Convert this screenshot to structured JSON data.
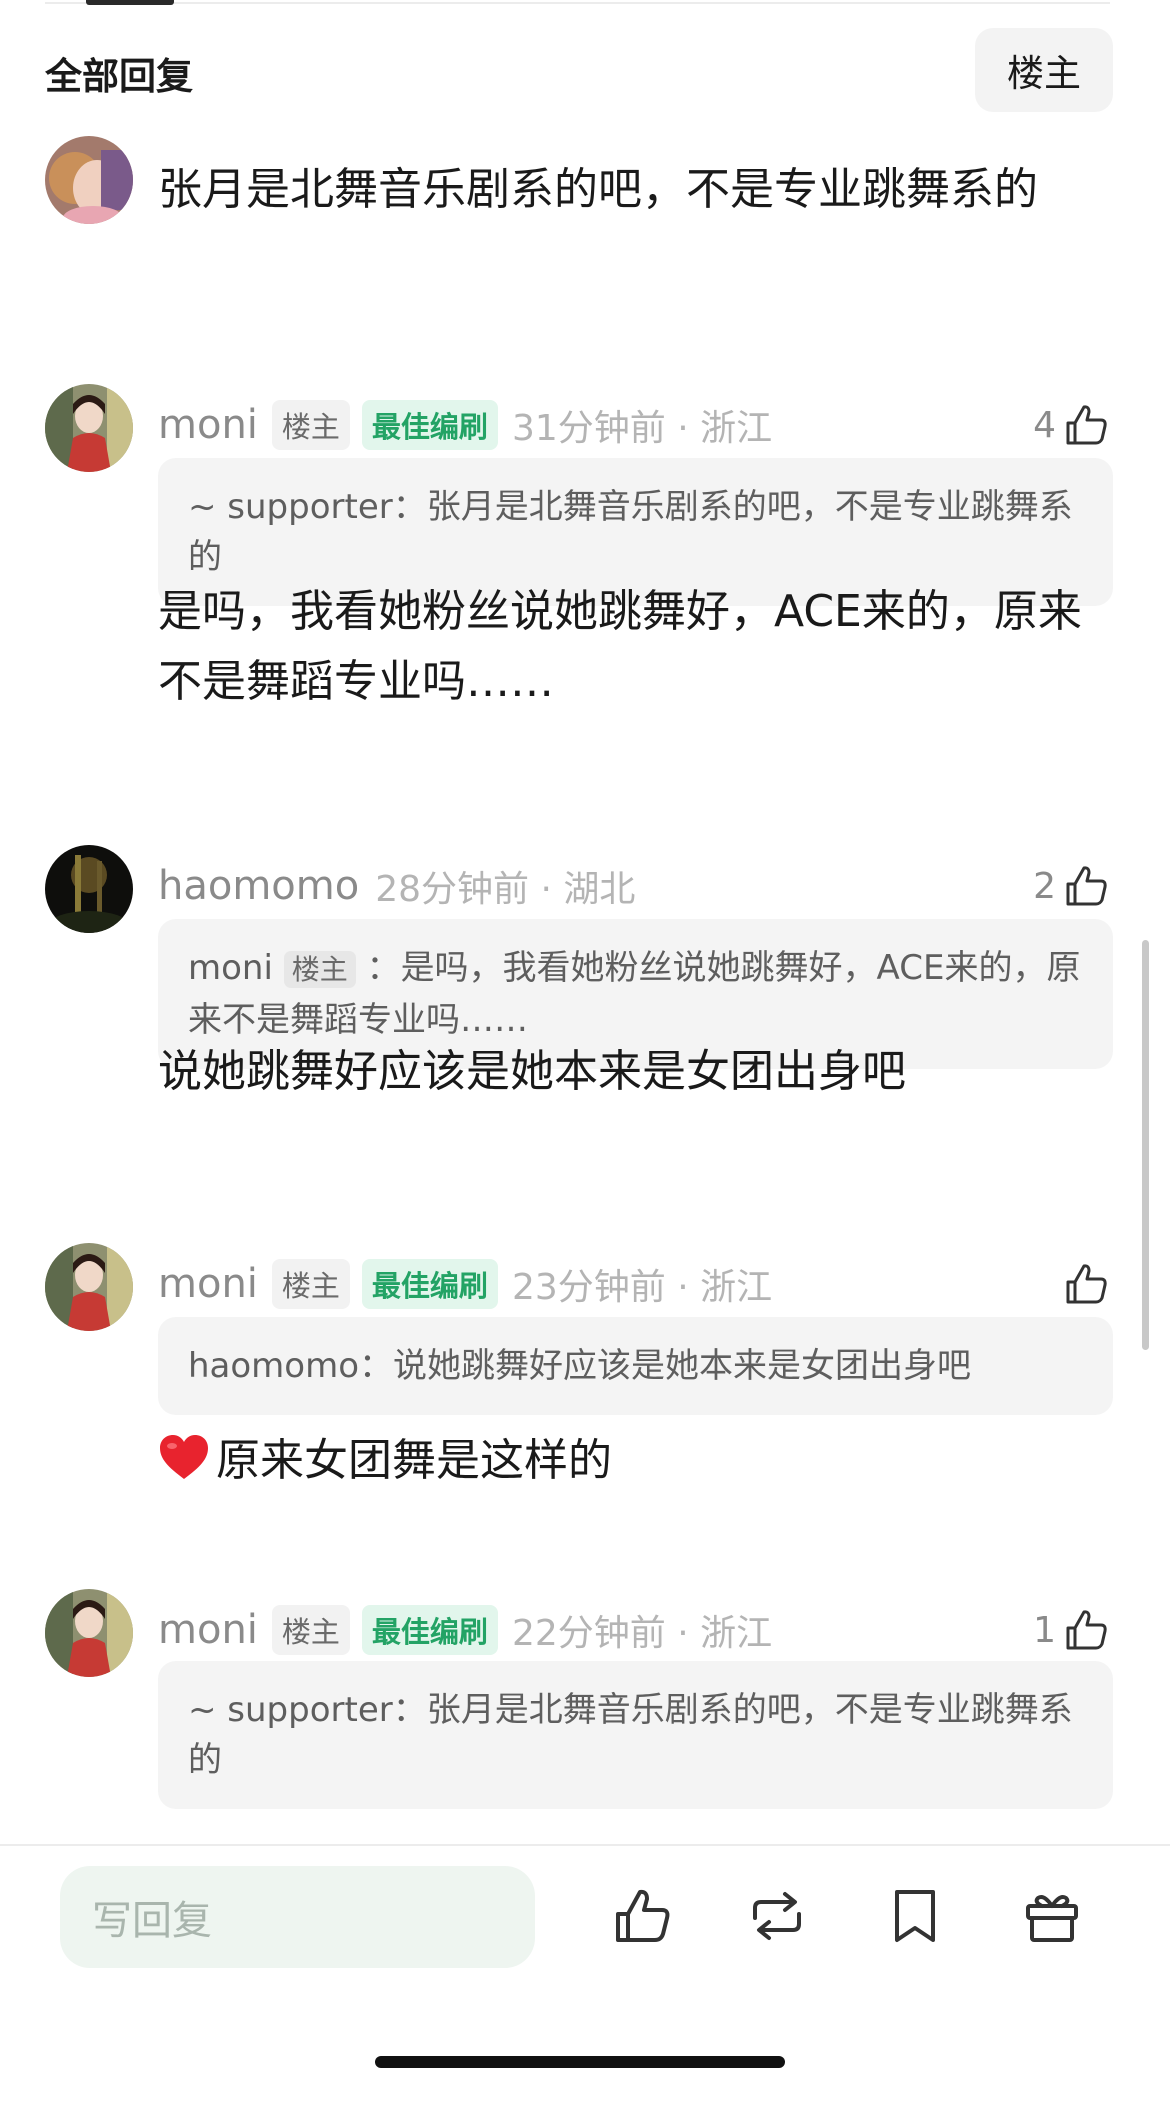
{
  "header": {
    "title": "全部回复",
    "owner_button": "楼主"
  },
  "comments": [
    {
      "body": "张月是北舞音乐剧系的吧，不是专业跳舞系的"
    },
    {
      "username": "moni",
      "owner_tag": "楼主",
      "best_tag": "最佳编刷",
      "time": "31分钟前 · 浙江",
      "likes": "4",
      "quote_user": "~ supporter",
      "quote_sep": "：",
      "quote_text": "张月是北舞音乐剧系的吧，不是专业跳舞系的",
      "body": "是吗，我看她粉丝说她跳舞好，ACE来的，原来不是舞蹈专业吗……"
    },
    {
      "username": "haomomo",
      "time": "28分钟前 · 湖北",
      "likes": "2",
      "quote_user": "moni",
      "quote_tag": "楼主",
      "quote_sep": " ：",
      "quote_text": "是吗，我看她粉丝说她跳舞好，ACE来的，原来不是舞蹈专业吗……",
      "body": "说她跳舞好应该是她本来是女团出身吧"
    },
    {
      "username": "moni",
      "owner_tag": "楼主",
      "best_tag": "最佳编刷",
      "time": "23分钟前 · 浙江",
      "quote_user": "haomomo",
      "quote_sep": "：",
      "quote_text": "说她跳舞好应该是她本来是女团出身吧",
      "body": "原来女团舞是这样的"
    },
    {
      "username": "moni",
      "owner_tag": "楼主",
      "best_tag": "最佳编刷",
      "time": "22分钟前 · 浙江",
      "likes": "1",
      "quote_user": "~ supporter",
      "quote_sep": "：",
      "quote_text": "张月是北舞音乐剧系的吧，不是专业跳舞系的"
    }
  ],
  "bottom": {
    "reply_placeholder": "写回复",
    "icons": [
      "thumb-up-icon",
      "repost-icon",
      "bookmark-icon",
      "gift-icon"
    ]
  },
  "icons": {
    "like": "thumb-up-icon",
    "heart_emoji": "heart-icon"
  },
  "colors": {
    "accent_green": "#23a365",
    "tag_green_bg": "#e2f6ec",
    "reply_bg": "#eef5f0"
  }
}
